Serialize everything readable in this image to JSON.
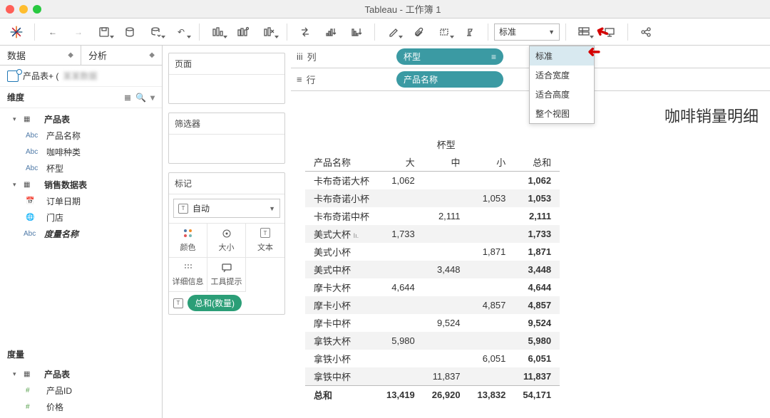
{
  "window": {
    "title": "Tableau - 工作簿 1"
  },
  "toolbar": {
    "fit_current": "标准",
    "fit_options": [
      "标准",
      "适合宽度",
      "适合高度",
      "整个视图"
    ]
  },
  "side": {
    "tab_data": "数据",
    "tab_analysis": "分析",
    "datasource": "产品表+ (",
    "dim_label": "维度",
    "measure_label": "度量",
    "tree": [
      {
        "type": "table",
        "label": "产品表",
        "expanded": true,
        "children": [
          {
            "type": "abc",
            "label": "产品名称"
          },
          {
            "type": "abc",
            "label": "咖啡种类"
          },
          {
            "type": "abc",
            "label": "杯型"
          }
        ]
      },
      {
        "type": "table",
        "label": "销售数据表",
        "expanded": true,
        "children": [
          {
            "type": "date",
            "label": "订单日期"
          },
          {
            "type": "globe",
            "label": "门店"
          }
        ]
      },
      {
        "type": "abc",
        "label": "度量名称",
        "italic": true
      }
    ],
    "measures": [
      {
        "type": "table",
        "label": "产品表",
        "expanded": true,
        "children": [
          {
            "type": "num",
            "label": "产品ID"
          },
          {
            "type": "num",
            "label": "价格"
          }
        ]
      }
    ]
  },
  "mid": {
    "pages": "页面",
    "filters": "筛选器",
    "marks": "标记",
    "mark_type": "自动",
    "mark_cells": [
      "颜色",
      "大小",
      "文本",
      "详细信息",
      "工具提示"
    ],
    "mark_pill": "总和(数量)"
  },
  "shelves": {
    "cols_label": "列",
    "cols_pill": "杯型",
    "rows_label": "行",
    "rows_pill": "产品名称"
  },
  "viz": {
    "title": "咖啡销量明细",
    "col_group": "杯型",
    "row_header": "产品名称",
    "columns": [
      "大",
      "中",
      "小"
    ],
    "total_label": "总和",
    "rows": [
      {
        "name": "卡布奇诺大杯",
        "vals": [
          "1,062",
          "",
          ""
        ],
        "total": "1,062"
      },
      {
        "name": "卡布奇诺小杯",
        "vals": [
          "",
          "",
          "1,053"
        ],
        "total": "1,053"
      },
      {
        "name": "卡布奇诺中杯",
        "vals": [
          "",
          "2,111",
          ""
        ],
        "total": "2,111"
      },
      {
        "name": "美式大杯",
        "vals": [
          "1,733",
          "",
          ""
        ],
        "total": "1,733",
        "bar": true
      },
      {
        "name": "美式小杯",
        "vals": [
          "",
          "",
          "1,871"
        ],
        "total": "1,871"
      },
      {
        "name": "美式中杯",
        "vals": [
          "",
          "3,448",
          ""
        ],
        "total": "3,448"
      },
      {
        "name": "摩卡大杯",
        "vals": [
          "4,644",
          "",
          ""
        ],
        "total": "4,644"
      },
      {
        "name": "摩卡小杯",
        "vals": [
          "",
          "",
          "4,857"
        ],
        "total": "4,857"
      },
      {
        "name": "摩卡中杯",
        "vals": [
          "",
          "9,524",
          ""
        ],
        "total": "9,524"
      },
      {
        "name": "拿铁大杯",
        "vals": [
          "5,980",
          "",
          ""
        ],
        "total": "5,980"
      },
      {
        "name": "拿铁小杯",
        "vals": [
          "",
          "",
          "6,051"
        ],
        "total": "6,051"
      },
      {
        "name": "拿铁中杯",
        "vals": [
          "",
          "11,837",
          ""
        ],
        "total": "11,837"
      }
    ],
    "grand": {
      "label": "总和",
      "vals": [
        "13,419",
        "26,920",
        "13,832"
      ],
      "total": "54,171"
    }
  },
  "chart_data": {
    "type": "table",
    "title": "咖啡销量明细",
    "row_dimension": "产品名称",
    "col_dimension": "杯型",
    "columns": [
      "大",
      "中",
      "小",
      "总和"
    ],
    "rows": [
      [
        "卡布奇诺大杯",
        1062,
        null,
        null,
        1062
      ],
      [
        "卡布奇诺小杯",
        null,
        null,
        1053,
        1053
      ],
      [
        "卡布奇诺中杯",
        null,
        2111,
        null,
        2111
      ],
      [
        "美式大杯",
        1733,
        null,
        null,
        1733
      ],
      [
        "美式小杯",
        null,
        null,
        1871,
        1871
      ],
      [
        "美式中杯",
        null,
        3448,
        null,
        3448
      ],
      [
        "摩卡大杯",
        4644,
        null,
        null,
        4644
      ],
      [
        "摩卡小杯",
        null,
        null,
        4857,
        4857
      ],
      [
        "摩卡中杯",
        null,
        9524,
        null,
        9524
      ],
      [
        "拿铁大杯",
        5980,
        null,
        null,
        5980
      ],
      [
        "拿铁小杯",
        null,
        null,
        6051,
        6051
      ],
      [
        "拿铁中杯",
        null,
        11837,
        null,
        11837
      ]
    ],
    "grand_total": [
      "总和",
      13419,
      26920,
      13832,
      54171
    ]
  }
}
